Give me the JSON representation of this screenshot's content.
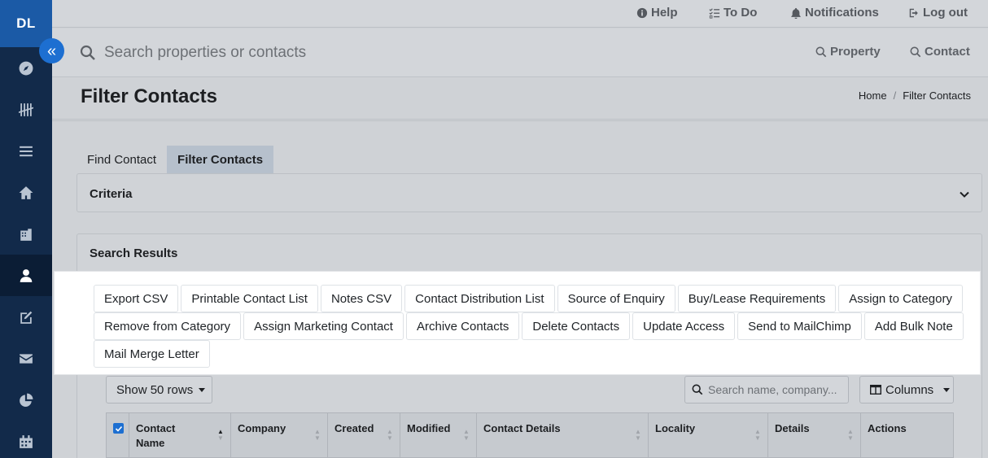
{
  "sidebar": {
    "logo": "DL",
    "items": [
      {
        "icon": "compass-icon"
      },
      {
        "icon": "tally-icon"
      },
      {
        "icon": "list-icon"
      },
      {
        "icon": "home-icon"
      },
      {
        "icon": "building-icon"
      },
      {
        "icon": "user-icon",
        "active": true
      },
      {
        "icon": "edit-icon"
      },
      {
        "icon": "envelope-icon"
      },
      {
        "icon": "pie-chart-icon"
      },
      {
        "icon": "calendar-icon"
      }
    ]
  },
  "topbar": {
    "help": "Help",
    "todo": "To Do",
    "notifications": "Notifications",
    "logout": "Log out"
  },
  "search": {
    "placeholder": "Search properties or contacts",
    "property": "Property",
    "contact": "Contact"
  },
  "page": {
    "title": "Filter Contacts",
    "breadcrumb": [
      "Home",
      "/",
      "Filter Contacts"
    ]
  },
  "tabs": [
    "Find Contact",
    "Filter Contacts"
  ],
  "criteria": {
    "title": "Criteria"
  },
  "results": {
    "title": "Search Results",
    "actions": [
      "Export CSV",
      "Printable Contact List",
      "Notes CSV",
      "Contact Distribution List",
      "Source of Enquiry",
      "Buy/Lease Requirements",
      "Assign to Category",
      "Remove from Category",
      "Assign Marketing Contact",
      "Archive Contacts",
      "Delete Contacts",
      "Update Access",
      "Send to MailChimp",
      "Add Bulk Note",
      "Mail Merge Letter"
    ],
    "rows_label": "Show 50 rows",
    "table_search_placeholder": "Search name, company...",
    "columns_label": "Columns",
    "headers": [
      {
        "label": "Contact Name",
        "sorted": "asc"
      },
      {
        "label": "Company"
      },
      {
        "label": "Created"
      },
      {
        "label": "Modified"
      },
      {
        "label": "Contact Details"
      },
      {
        "label": "Locality"
      },
      {
        "label": "Details"
      },
      {
        "label": "Actions"
      }
    ]
  },
  "colors": {
    "sidebar": "#122a4a",
    "accent": "#1d6fd1",
    "logo_bg": "#1b5aa6"
  }
}
